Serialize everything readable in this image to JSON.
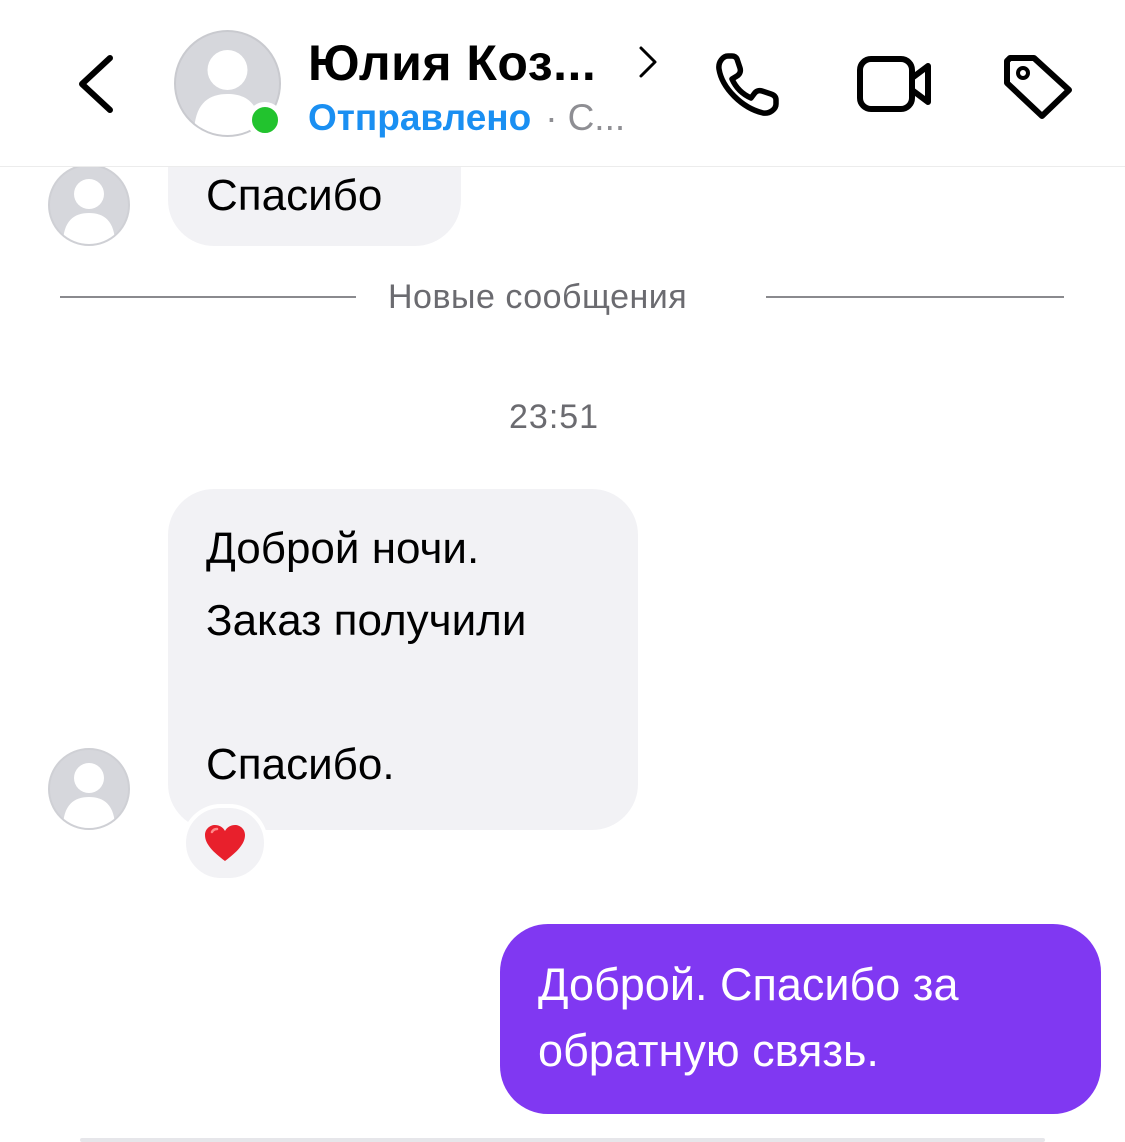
{
  "header": {
    "contact_name": "Юлия Коз...",
    "status_sent": "Отправлено",
    "status_separator": "·",
    "status_rest": "С..."
  },
  "messages": {
    "prev_incoming": "Спасибо",
    "divider_label": "Новые сообщения",
    "timestamp": "23:51",
    "incoming_line1": "Доброй ночи.",
    "incoming_line2": "Заказ получили",
    "incoming_line3": "Спасибо.",
    "outgoing_line1": "Доброй. Спасибо за",
    "outgoing_line2": "обратную связь."
  },
  "colors": {
    "accent_blue": "#1a8ff2",
    "online_green": "#22c32e",
    "outgoing_bubble": "#8038f2",
    "incoming_bubble": "#f2f2f5"
  }
}
